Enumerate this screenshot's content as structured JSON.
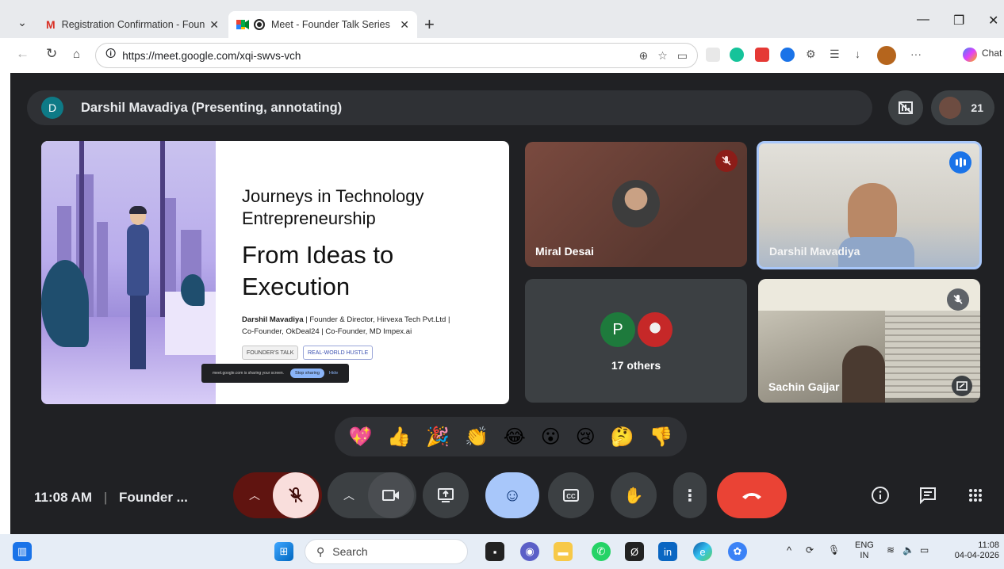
{
  "browser": {
    "tabs": [
      {
        "title": "Registration Confirmation - Found",
        "active": false
      },
      {
        "title": "Meet - Founder Talk Series",
        "active": true
      }
    ],
    "url": "https://meet.google.com/xqi-swvs-vch",
    "toolbar_right_label": "Chat"
  },
  "meet": {
    "presenter_label": "Darshil Mavadiya (Presenting, annotating)",
    "presenter_initial": "D",
    "participant_count": "21",
    "slide": {
      "title_line1": "Journeys in Technology",
      "title_line2": "Entrepreneurship",
      "heading_line1": "From Ideas to",
      "heading_line2": "Execution",
      "byline_name": "Darshil Mavadiya",
      "byline_rest1": " | Founder & Director, Hirvexa Tech Pvt.Ltd |",
      "byline_rest2": "Co-Founder, OkDeal24 | Co-Founder, MD Impex.ai",
      "tags": [
        "FOUNDER'S TALK",
        "REAL-WORLD HUSTLE"
      ],
      "share_notice": "meet.google.com is sharing your screen.",
      "stop_sharing": "Stop sharing",
      "hide": "Hide"
    },
    "tiles": {
      "miral": "Miral Desai",
      "darshil": "Darshil Mavadiya",
      "others_initial": "P",
      "others_label": "17 others",
      "sachin": "Sachin Gajjar"
    },
    "reactions": [
      "💖",
      "👍",
      "🎉",
      "👏",
      "😂",
      "😮",
      "😢",
      "🤔",
      "👎"
    ],
    "bottom": {
      "time": "11:08 AM",
      "separator": "|",
      "meeting_name": "Founder ..."
    }
  },
  "taskbar": {
    "search_placeholder": "Search",
    "lang_top": "ENG",
    "lang_bottom": "IN",
    "clock_time": "11:08",
    "clock_date": "04-04-2026"
  }
}
